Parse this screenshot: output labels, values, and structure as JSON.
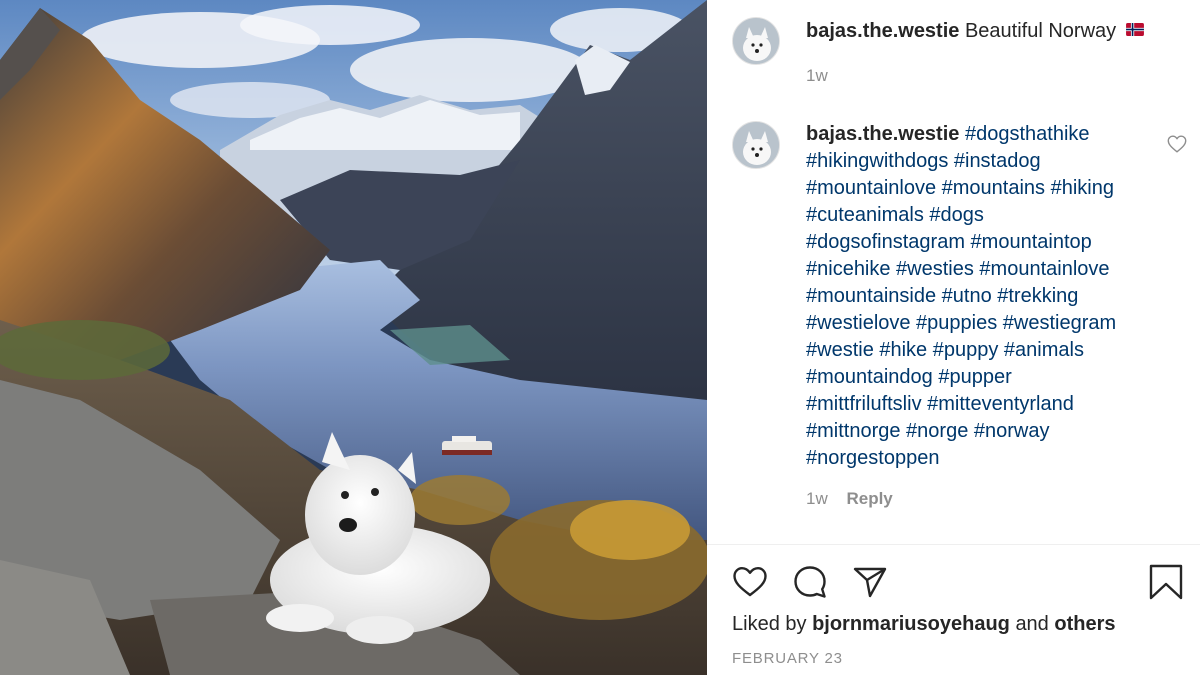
{
  "post": {
    "username": "bajas.the.westie",
    "caption": "Beautiful Norway",
    "caption_flag": "norway-flag",
    "time": "1w"
  },
  "comment": {
    "username": "bajas.the.westie",
    "lines": [
      "#dogsthathike",
      "#hikingwithdogs #instadog",
      "#mountainlove #mountains #hiking",
      "#cuteanimals #dogs",
      "#dogsofinstagram #mountaintop",
      "#nicehike #westies #mountainlove",
      "#mountainside #utno #trekking",
      "#westielove #puppies #westiegram",
      "#westie #hike #puppy #animals",
      "#mountaindog #pupper",
      "#mittfriluftsliv #mitteventyrland",
      "#mittnorge #norge #norway",
      "#norgestoppen"
    ],
    "time": "1w",
    "reply_label": "Reply"
  },
  "actions": {
    "icons": [
      "heart-icon",
      "comment-icon",
      "share-icon",
      "bookmark-icon"
    ]
  },
  "likes": {
    "prefix": "Liked by",
    "user": "bjornmariusoyehaug",
    "middle": "and",
    "suffix": "others"
  },
  "date": "FEBRUARY 23",
  "colors": {
    "hashtag": "#00376b",
    "muted": "#8e8e8e",
    "text": "#262626"
  }
}
